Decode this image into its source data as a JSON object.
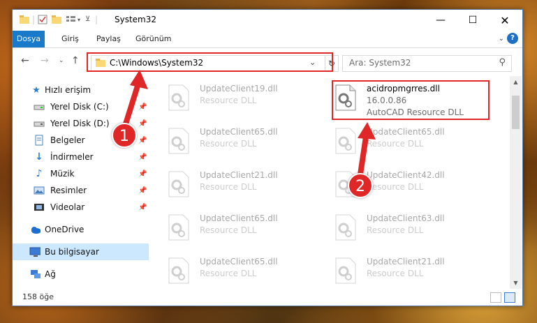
{
  "window": {
    "title": "System32"
  },
  "ribbon": {
    "tabs": [
      "Dosya",
      "Giriş",
      "Paylaş",
      "Görünüm"
    ]
  },
  "address": {
    "path": "C:\\Windows\\System32"
  },
  "search": {
    "placeholder": "Ara: System32"
  },
  "sidebar": {
    "items": [
      {
        "label": "Hızlı erişim",
        "icon": "star-icon"
      },
      {
        "label": "Yerel Disk (C:)",
        "icon": "drive-icon"
      },
      {
        "label": "Yerel Disk (D:)",
        "icon": "drive-icon"
      },
      {
        "label": "Belgeler",
        "icon": "documents-icon"
      },
      {
        "label": "İndirmeler",
        "icon": "download-icon"
      },
      {
        "label": "Müzik",
        "icon": "music-icon"
      },
      {
        "label": "Resimler",
        "icon": "pictures-icon"
      },
      {
        "label": "Videolar",
        "icon": "videos-icon"
      },
      {
        "label": "OneDrive",
        "icon": "cloud-icon"
      },
      {
        "label": "Bu bilgisayar",
        "icon": "computer-icon"
      },
      {
        "label": "Ağ",
        "icon": "network-icon"
      }
    ]
  },
  "files": [
    {
      "name": "UpdateClient19.dll",
      "type": "Resource DLL"
    },
    {
      "name": "acidropmgrres.dll",
      "version": "16.0.0.86",
      "type": "AutoCAD Resource DLL"
    },
    {
      "name": "UpdateClient65.dll",
      "type": "Resource DLL"
    },
    {
      "name": "UpdateClient65.dll",
      "type": "Resource DLL"
    },
    {
      "name": "UpdateClient21.dll",
      "type": "Resource DLL"
    },
    {
      "name": "UpdateClient42.dll",
      "type": "Resource DLL"
    },
    {
      "name": "UpdateClient65.dll",
      "type": "Resource DLL"
    },
    {
      "name": "UpdateClient63.dll",
      "type": "Resource DLL"
    },
    {
      "name": "UpdateClient65.dll",
      "type": "Resource DLL"
    },
    {
      "name": "UpdateClient21.dll",
      "type": "Resource DLL"
    }
  ],
  "status": {
    "count": "158 öğe"
  },
  "annotations": {
    "badge1": "1",
    "badge2": "2",
    "color": "#e02727"
  }
}
